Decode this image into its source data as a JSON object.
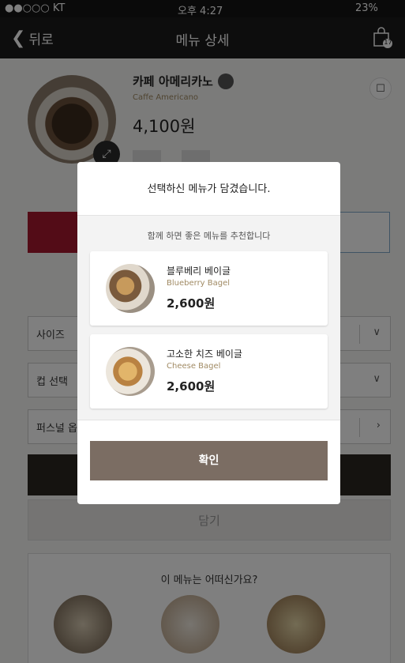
{
  "status": {
    "carrier": "●●○○○ KT",
    "time": "오후 4:27",
    "battery": "23%"
  },
  "nav": {
    "back_label": "뒤로",
    "title": "메뉴 상세",
    "cart_count": "17"
  },
  "product": {
    "name": "카페 아메리카노",
    "name_en": "Caffe Americano",
    "price": "4,100원"
  },
  "options": [
    {
      "label": "사이즈"
    },
    {
      "label": "컵 선택"
    },
    {
      "label": "퍼스널 옵션"
    }
  ],
  "add_label": "담기",
  "how_label": "이 메뉴는 어떠신가요?",
  "modal": {
    "title": "선택하신 메뉴가 담겼습니다.",
    "subtitle": "함께 하면 좋은 메뉴를 추천합니다",
    "items": [
      {
        "name": "블루베리 베이글",
        "name_en": "Blueberry Bagel",
        "price": "2,600원"
      },
      {
        "name": "고소한 치즈 베이글",
        "name_en": "Cheese Bagel",
        "price": "2,600원"
      }
    ],
    "confirm_label": "확인"
  },
  "colors": {
    "accent": "#a6192e",
    "confirm": "#7b6d63",
    "gold": "#a08a63"
  }
}
